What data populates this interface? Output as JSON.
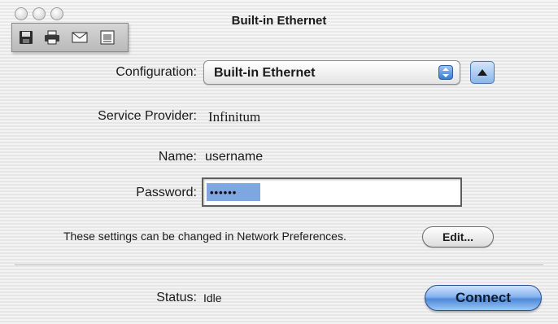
{
  "window": {
    "title": "Built-in Ethernet"
  },
  "toolbar": {
    "icons": [
      "save-icon",
      "print-icon",
      "mail-icon",
      "document-icon"
    ]
  },
  "form": {
    "configuration_label": "Configuration:",
    "configuration_value": "Built-in Ethernet",
    "service_provider_label": "Service Provider:",
    "service_provider_value": "Infinitum",
    "name_label": "Name:",
    "name_value": "username",
    "password_label": "Password:",
    "password_value": "••••••"
  },
  "settings_note": "These settings can be changed in Network Preferences.",
  "buttons": {
    "edit": "Edit...",
    "connect": "Connect"
  },
  "status": {
    "label": "Status:",
    "value": "Idle"
  },
  "colors": {
    "accent": "#4f89d8",
    "selection": "#7ea6e0"
  }
}
